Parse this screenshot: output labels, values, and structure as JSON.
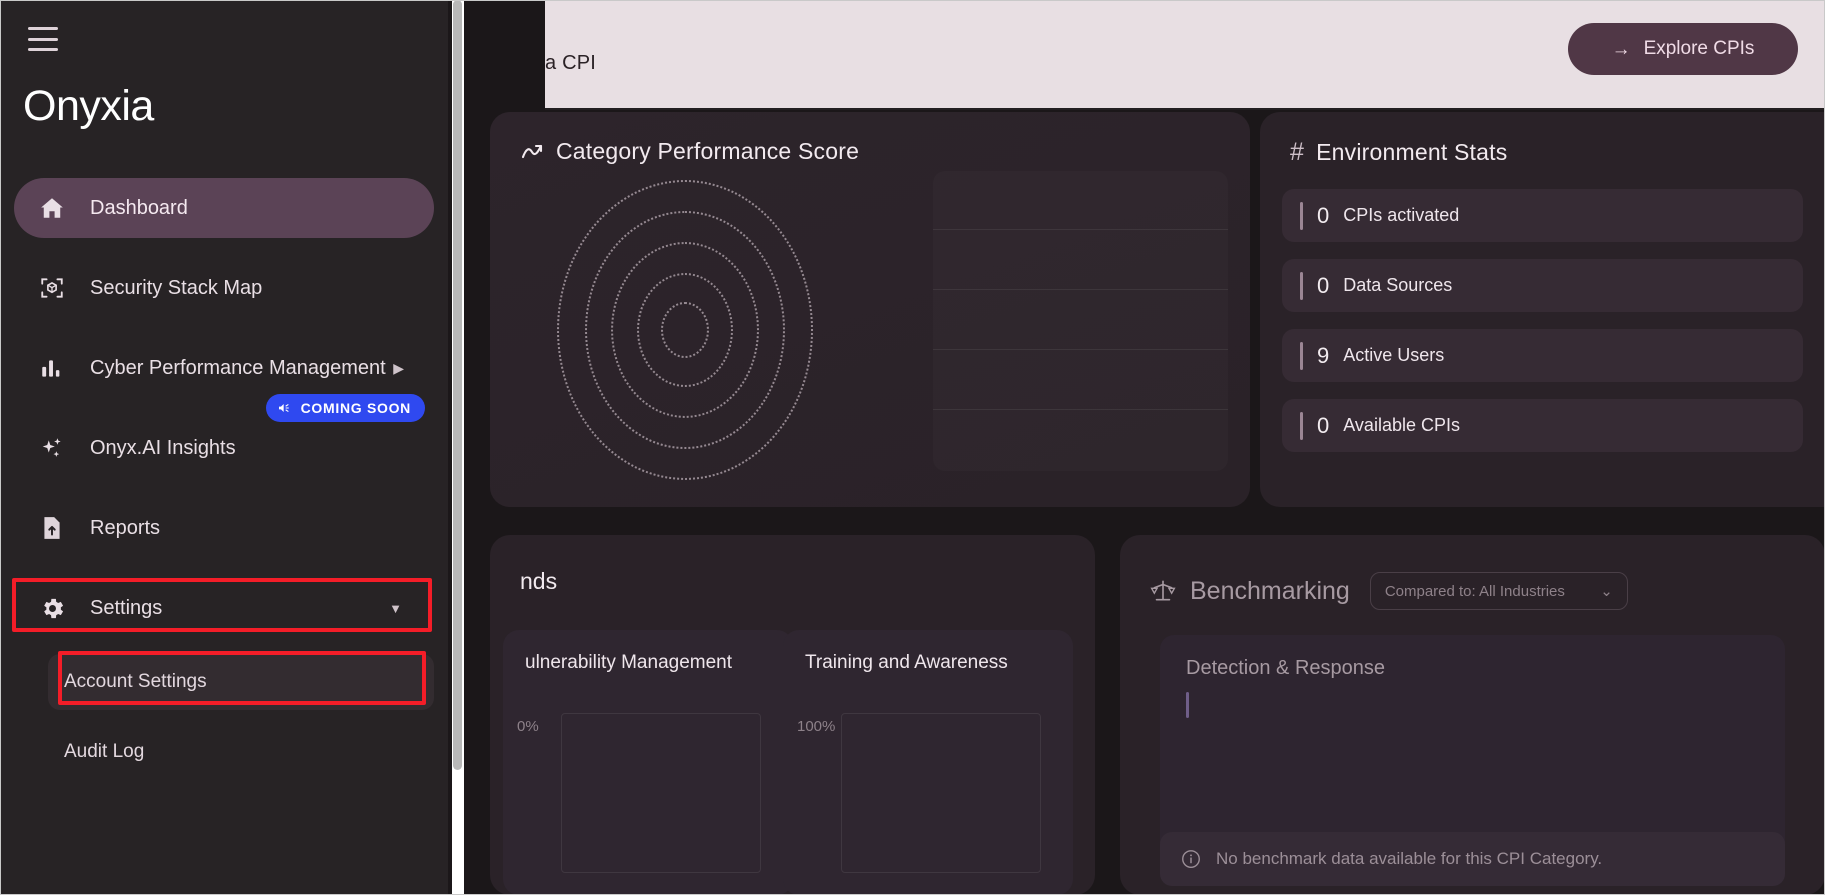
{
  "app": {
    "brand": "Onyxia"
  },
  "header": {
    "banner_text": "a CPI",
    "explore_button": "Explore CPIs",
    "explore_arrow": "→"
  },
  "sidebar": {
    "menu_icon": "hamburger-icon",
    "items": [
      {
        "label": "Dashboard",
        "icon": "home-icon",
        "active": true
      },
      {
        "label": "Security Stack Map",
        "icon": "cube-scan-icon",
        "active": false
      },
      {
        "label": "Cyber Performance Management",
        "icon": "bar-chart-icon",
        "active": false,
        "chevron": "▶"
      },
      {
        "label": "Onyx.AI Insights",
        "icon": "sparkles-icon",
        "active": false,
        "badge": "COMING SOON",
        "badge_icon": "megaphone-icon"
      },
      {
        "label": "Reports",
        "icon": "report-upload-icon",
        "active": false
      },
      {
        "label": "Settings",
        "icon": "gear-icon",
        "active": false,
        "chevron": "▼",
        "highlighted": true
      }
    ],
    "sub_items": [
      {
        "label": "Account Settings",
        "highlighted": true
      },
      {
        "label": "Audit Log",
        "highlighted": false
      }
    ]
  },
  "main": {
    "category_performance": {
      "title": "Category Performance Score",
      "icon": "trend-chart-icon"
    },
    "environment_stats": {
      "title": "Environment Stats",
      "icon": "hash-icon",
      "stats": [
        {
          "value": "0",
          "label": "CPIs activated"
        },
        {
          "value": "0",
          "label": "Data Sources"
        },
        {
          "value": "9",
          "label": "Active Users"
        },
        {
          "value": "0",
          "label": "Available CPIs"
        }
      ]
    },
    "trends": {
      "title": "nds",
      "cards": [
        {
          "title": "ulnerability Management",
          "axis_label": "0%"
        },
        {
          "title": "Training and Awareness",
          "axis_label": "100%"
        }
      ]
    },
    "benchmarking": {
      "title": "Benchmarking",
      "icon": "scales-icon",
      "selector": "Compared to: All Industries",
      "selector_chevron": "⌄",
      "category": "Detection & Response",
      "message": "No benchmark data available for this CPI Category.",
      "message_icon": "info-icon"
    }
  },
  "colors": {
    "accent_purple": "#5b4356",
    "badge_blue": "#2f49f0",
    "annotation_red": "#f41d28",
    "banner_bg": "#e8dfe3"
  }
}
